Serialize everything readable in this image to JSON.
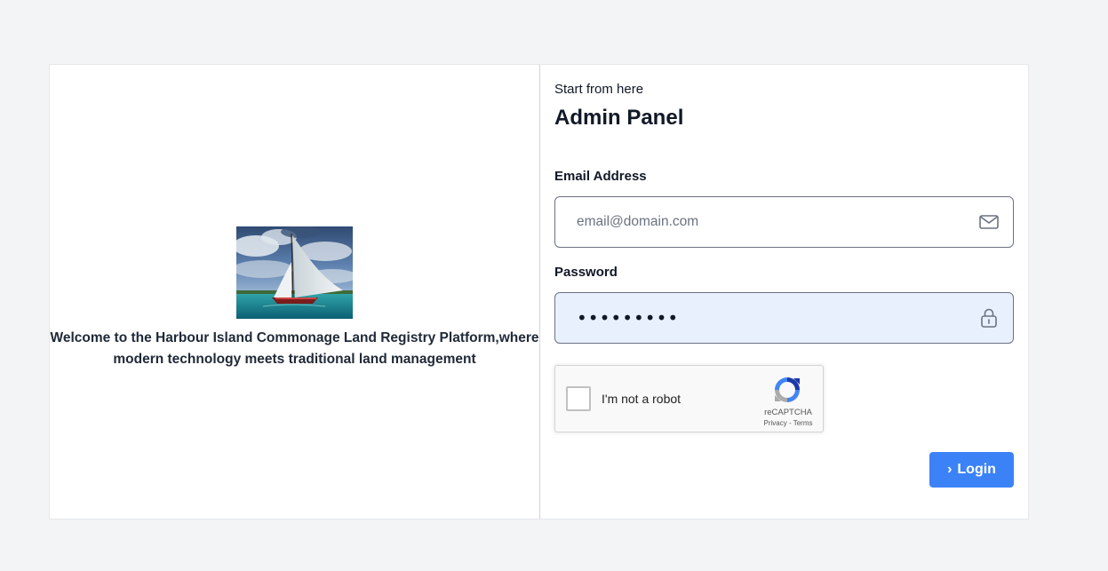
{
  "welcome": {
    "message": "Welcome to the Harbour Island Commonage Land Registry Platform,where modern technology meets traditional land management"
  },
  "header": {
    "eyebrow": "Start from here",
    "title": "Admin Panel"
  },
  "email": {
    "label": "Email Address",
    "placeholder": "email@domain.com",
    "value": "",
    "icon": "envelope-icon"
  },
  "password": {
    "label": "Password",
    "value": "•••••••••",
    "icon": "lock-icon"
  },
  "recaptcha": {
    "label": "I'm not a robot",
    "brand": "reCAPTCHA",
    "privacy": "Privacy",
    "separator": " - ",
    "terms": "Terms"
  },
  "login": {
    "label": "Login",
    "icon": "chevron-right-icon",
    "color": "#3b82f6"
  },
  "colors": {
    "background": "#f3f4f6",
    "password_fill": "#e8f0fe"
  }
}
